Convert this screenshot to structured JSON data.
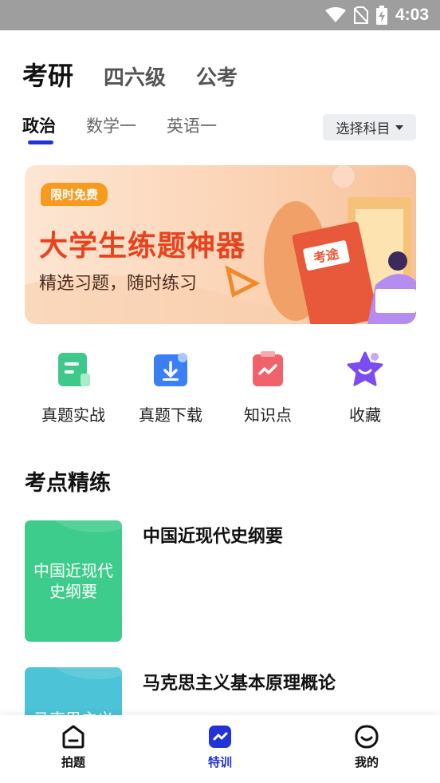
{
  "status_bar": {
    "time": "4:03",
    "icons": [
      "wifi-icon",
      "no-sim-icon",
      "battery-charging-icon"
    ]
  },
  "top_tabs": [
    {
      "label": "考研",
      "active": true
    },
    {
      "label": "四六级",
      "active": false
    },
    {
      "label": "公考",
      "active": false
    }
  ],
  "subject_tabs": [
    {
      "label": "政治",
      "active": true
    },
    {
      "label": "数学一",
      "active": false
    },
    {
      "label": "英语一",
      "active": false
    }
  ],
  "select_subject": {
    "label": "选择科目"
  },
  "banner": {
    "badge": "限时免费",
    "headline": "大学生练题神器",
    "subtitle": "精选习题，随时练习",
    "book_label": "考途"
  },
  "quick_actions": [
    {
      "label": "真题实战",
      "icon": "exam-sheet-icon",
      "color": "#3ec98a"
    },
    {
      "label": "真题下载",
      "icon": "download-icon",
      "color": "#3b7ff5"
    },
    {
      "label": "知识点",
      "icon": "clipboard-chart-icon",
      "color": "#f0636b"
    },
    {
      "label": "收藏",
      "icon": "star-icon",
      "color": "#7b4df0"
    }
  ],
  "section": {
    "title": "考点精练"
  },
  "courses": [
    {
      "cover_text": "中国近现代史纲要",
      "title": "中国近现代史纲要",
      "color": "#3ecc8c"
    },
    {
      "cover_text": "马克思主义",
      "title": "马克思主义基本原理概论",
      "color": "#4cc3d6"
    }
  ],
  "bottom_nav": [
    {
      "label": "拍题",
      "icon": "camera-icon",
      "active": false
    },
    {
      "label": "特训",
      "icon": "training-chart-icon",
      "active": true
    },
    {
      "label": "我的",
      "icon": "smiley-face-icon",
      "active": false
    }
  ],
  "colors": {
    "accent": "#2234d8",
    "banner_red": "#e8421e",
    "badge_orange": "#f79a1e"
  }
}
